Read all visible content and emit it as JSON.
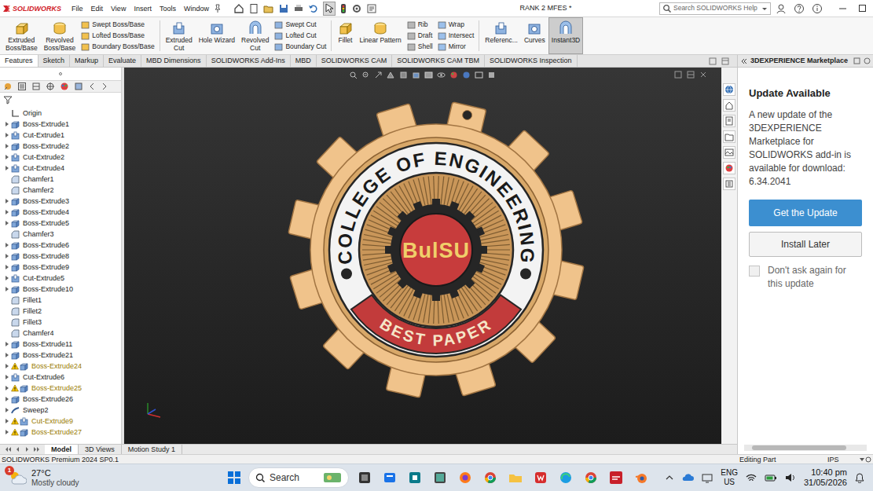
{
  "window": {
    "title": "RANK 2 MFES *"
  },
  "app": {
    "logo": "SOLIDWORKS"
  },
  "menu": [
    "File",
    "Edit",
    "View",
    "Insert",
    "Tools",
    "Window"
  ],
  "search": {
    "placeholder": "Search SOLIDWORKS Help"
  },
  "ribbon": [
    {
      "kind": "large",
      "lines": [
        "Extruded",
        "Boss/Base"
      ],
      "selected": false
    },
    {
      "kind": "large",
      "lines": [
        "Revolved",
        "Boss/Base"
      ],
      "selected": false
    },
    {
      "kind": "stack",
      "entries": [
        "Swept Boss/Base",
        "Lofted Boss/Base",
        "Boundary Boss/Base"
      ]
    },
    {
      "kind": "separator"
    },
    {
      "kind": "large",
      "lines": [
        "Extruded",
        "Cut"
      ],
      "selected": false
    },
    {
      "kind": "large",
      "lines": [
        "Hole Wizard"
      ],
      "selected": false
    },
    {
      "kind": "large",
      "lines": [
        "Revolved",
        "Cut"
      ],
      "selected": false
    },
    {
      "kind": "stack",
      "entries": [
        "Swept Cut",
        "Lofted Cut",
        "Boundary Cut"
      ]
    },
    {
      "kind": "separator"
    },
    {
      "kind": "large",
      "lines": [
        "Fillet"
      ],
      "selected": false
    },
    {
      "kind": "large",
      "lines": [
        "Linear Pattern"
      ],
      "selected": false
    },
    {
      "kind": "stack",
      "entries": [
        "Rib",
        "Draft",
        "Shell"
      ]
    },
    {
      "kind": "stack",
      "entries": [
        "Wrap",
        "Intersect",
        "Mirror"
      ]
    },
    {
      "kind": "separator"
    },
    {
      "kind": "large",
      "lines": [
        "Referenc..."
      ],
      "selected": false
    },
    {
      "kind": "large",
      "lines": [
        "Curves"
      ],
      "selected": false
    },
    {
      "kind": "large",
      "lines": [
        "Instant3D"
      ],
      "selected": true
    }
  ],
  "command_tabs": [
    {
      "label": "Features",
      "selected": true
    },
    {
      "label": "Sketch",
      "selected": false
    },
    {
      "label": "Markup",
      "selected": false
    },
    {
      "label": "Evaluate",
      "selected": false
    },
    {
      "label": "MBD Dimensions",
      "selected": false
    },
    {
      "label": "SOLIDWORKS Add-Ins",
      "selected": false
    },
    {
      "label": "MBD",
      "selected": false
    },
    {
      "label": "SOLIDWORKS CAM",
      "selected": false
    },
    {
      "label": "SOLIDWORKS CAM TBM",
      "selected": false
    },
    {
      "label": "SOLIDWORKS Inspection",
      "selected": false
    }
  ],
  "feature_tree": {
    "items": [
      {
        "label": "Origin",
        "kind": "origin",
        "expandable": false,
        "warning": false
      },
      {
        "label": "Boss-Extrude1",
        "kind": "boss",
        "expandable": true,
        "warning": false
      },
      {
        "label": "Cut-Extrude1",
        "kind": "cut",
        "expandable": true,
        "warning": false
      },
      {
        "label": "Boss-Extrude2",
        "kind": "boss",
        "expandable": true,
        "warning": false
      },
      {
        "label": "Cut-Extrude2",
        "kind": "cut",
        "expandable": true,
        "warning": false
      },
      {
        "label": "Cut-Extrude4",
        "kind": "cut",
        "expandable": true,
        "warning": false
      },
      {
        "label": "Chamfer1",
        "kind": "chamfer",
        "expandable": false,
        "warning": false
      },
      {
        "label": "Chamfer2",
        "kind": "chamfer",
        "expandable": false,
        "warning": false
      },
      {
        "label": "Boss-Extrude3",
        "kind": "boss",
        "expandable": true,
        "warning": false
      },
      {
        "label": "Boss-Extrude4",
        "kind": "boss",
        "expandable": true,
        "warning": false
      },
      {
        "label": "Boss-Extrude5",
        "kind": "boss",
        "expandable": true,
        "warning": false
      },
      {
        "label": "Chamfer3",
        "kind": "chamfer",
        "expandable": false,
        "warning": false
      },
      {
        "label": "Boss-Extrude6",
        "kind": "boss",
        "expandable": true,
        "warning": false
      },
      {
        "label": "Boss-Extrude8",
        "kind": "boss",
        "expandable": true,
        "warning": false
      },
      {
        "label": "Boss-Extrude9",
        "kind": "boss",
        "expandable": true,
        "warning": false
      },
      {
        "label": "Cut-Extrude5",
        "kind": "cut",
        "expandable": true,
        "warning": false
      },
      {
        "label": "Boss-Extrude10",
        "kind": "boss",
        "expandable": true,
        "warning": false
      },
      {
        "label": "Fillet1",
        "kind": "fillet",
        "expandable": false,
        "warning": false
      },
      {
        "label": "Fillet2",
        "kind": "fillet",
        "expandable": false,
        "warning": false
      },
      {
        "label": "Fillet3",
        "kind": "fillet",
        "expandable": false,
        "warning": false
      },
      {
        "label": "Chamfer4",
        "kind": "chamfer",
        "expandable": false,
        "warning": false
      },
      {
        "label": "Boss-Extrude11",
        "kind": "boss",
        "expandable": true,
        "warning": false
      },
      {
        "label": "Boss-Extrude21",
        "kind": "boss",
        "expandable": true,
        "warning": false
      },
      {
        "label": "Boss-Extrude24",
        "kind": "boss",
        "expandable": true,
        "warning": true
      },
      {
        "label": "Cut-Extrude6",
        "kind": "cut",
        "expandable": true,
        "warning": false
      },
      {
        "label": "Boss-Extrude25",
        "kind": "boss",
        "expandable": true,
        "warning": true
      },
      {
        "label": "Boss-Extrude26",
        "kind": "boss",
        "expandable": true,
        "warning": false
      },
      {
        "label": "Sweep2",
        "kind": "sweep",
        "expandable": true,
        "warning": false
      },
      {
        "label": "Cut-Extrude9",
        "kind": "cut",
        "expandable": true,
        "warning": true
      },
      {
        "label": "Boss-Extrude27",
        "kind": "boss",
        "expandable": true,
        "warning": true
      }
    ]
  },
  "viewport": {
    "medal": {
      "ring_text": "COLLEGE OF ENGINEERING",
      "center_text": "BulSU",
      "banner_text": "BEST PAPER"
    }
  },
  "task_pane": {
    "title": "3DEXPERIENCE Marketplace",
    "heading": "Update Available",
    "message": "A new update of the 3DEXPERIENCE Marketplace for SOLIDWORKS add-in is available for download: 6.34.2041",
    "primary_button": "Get the Update",
    "secondary_button": "Install Later",
    "checkbox": {
      "label": "Don't ask again for this update",
      "checked": false
    }
  },
  "bottom_tabs": [
    {
      "label": "Model",
      "selected": true
    },
    {
      "label": "3D Views",
      "selected": false
    },
    {
      "label": "Motion Study 1",
      "selected": false
    }
  ],
  "status_bar": {
    "product": "SOLIDWORKS Premium 2024 SP0.1",
    "mode": "Editing Part",
    "units": "IPS"
  },
  "taskbar": {
    "weather": {
      "temperature": "27°C",
      "condition": "Mostly cloudy",
      "badge": "1"
    },
    "search": "Search",
    "language": [
      "ENG",
      "US"
    ],
    "time": "10:40 pm",
    "date": "31/05/2026"
  }
}
